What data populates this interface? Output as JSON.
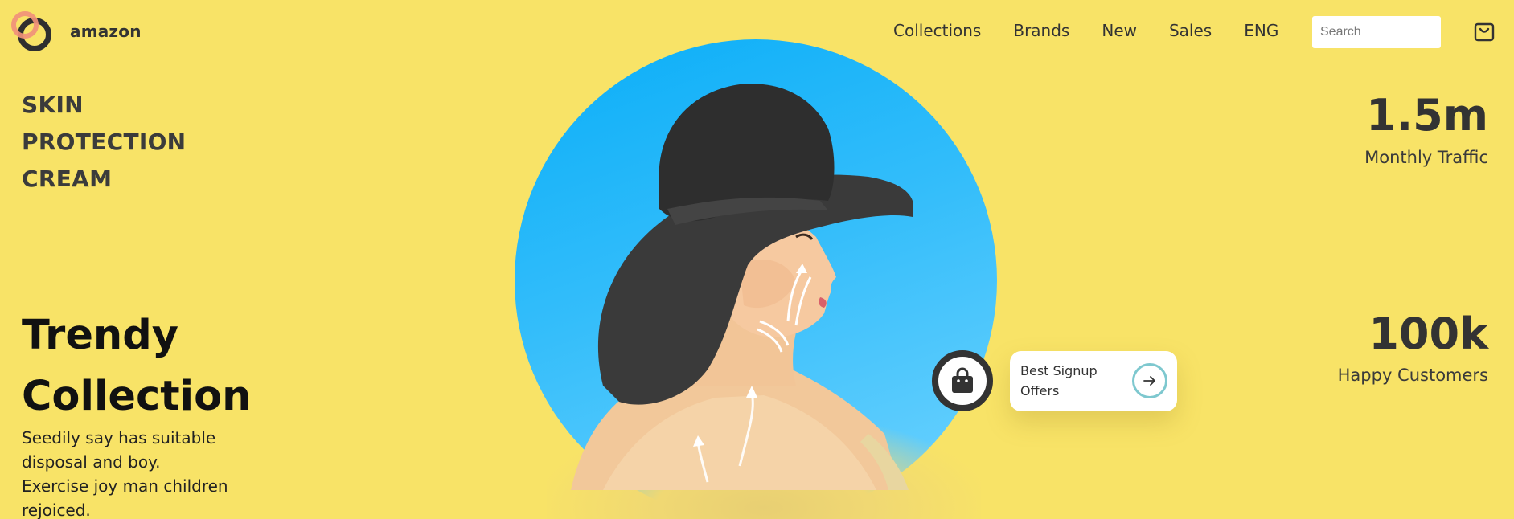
{
  "header": {
    "brand": "amazon",
    "nav": [
      {
        "label": "Collections"
      },
      {
        "label": "Brands"
      },
      {
        "label": "New"
      },
      {
        "label": "Sales"
      },
      {
        "label": "ENG"
      }
    ],
    "search": {
      "placeholder": "Search",
      "value": ""
    },
    "cart_icon": "shopping-bag-icon"
  },
  "hero": {
    "product_lines": [
      "SKIN",
      "PROTECTION",
      "CREAM"
    ],
    "headline_lines": [
      "Trendy",
      "Collection"
    ],
    "description_lines": [
      "Seedily say has suitable",
      "disposal and boy.",
      "Exercise joy man children",
      "rejoiced."
    ],
    "image_icon": "woman-in-hat-image",
    "offer": {
      "line1": "Best Signup",
      "line2": "Offers",
      "arrow_icon": "arrow-right-icon"
    },
    "bag_icon": "bag-icon"
  },
  "stats": [
    {
      "value": "1.5m",
      "label": "Monthly Traffic"
    },
    {
      "value": "100k",
      "label": "Happy Customers"
    }
  ],
  "colors": {
    "background": "#f8e367",
    "hero_circle": "#0aaef8",
    "text_dark": "#333333",
    "accent_ring": "#f0917a",
    "arrow_ring": "#7ec8cf"
  }
}
